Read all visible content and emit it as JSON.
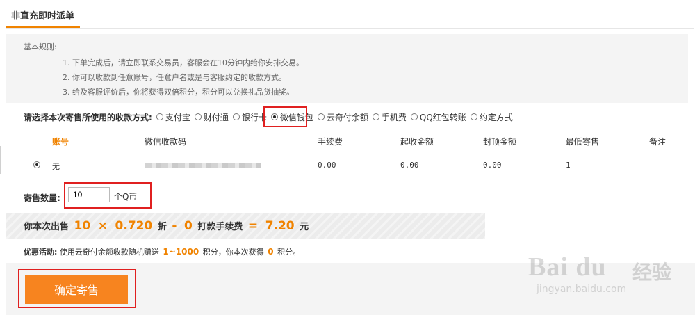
{
  "tab": {
    "label": "非直充即时派单"
  },
  "rules": {
    "title": "基本规则:",
    "items": [
      "1. 下单完成后，请立即联系交易员，客服会在10分钟内给你安排交易。",
      "2. 你可以收款到任意账号，任意户名或是与客服约定的收款方式。",
      "3. 给及客服评价后，你将获得双倍积分，积分可以兑换礼品货抽奖。"
    ]
  },
  "payment": {
    "label": "请选择本次寄售所使用的收款方式:",
    "selected": "微信钱包",
    "options": [
      "支付宝",
      "财付通",
      "银行卡",
      "微信钱包",
      "云奇付余额",
      "手机费",
      "QQ红包转账",
      "约定方式"
    ]
  },
  "account_table": {
    "headers": [
      "账号",
      "微信收款码",
      "手续费",
      "起收金额",
      "封顶金额",
      "最低寄售",
      "备注"
    ],
    "row": {
      "account": "无",
      "fee": "0.00",
      "min_amount": "0.00",
      "max_amount": "0.00",
      "min_sale": "1",
      "note": ""
    }
  },
  "quantity": {
    "label": "寄售数量:",
    "value": "10",
    "unit": "个Q币"
  },
  "calculation": {
    "prefix": "你本次出售",
    "qty": "10",
    "times": "×",
    "rate": "0.720",
    "zhe": "折",
    "minus": "-",
    "fee": "0",
    "fee_label": "打款手续费",
    "equals": "=",
    "total": "7.20",
    "currency": "元"
  },
  "promo": {
    "label": "优惠活动:",
    "text1": "使用云奇付余额收款随机赠送",
    "range": "1~1000",
    "text2": "积分，你本次获得",
    "points": "0",
    "text3": "积分。"
  },
  "confirm_button": {
    "label": "确定寄售"
  },
  "watermark": {
    "brand": "Bai du",
    "cn": "经验",
    "url": "jingyan.baidu.com"
  },
  "colors": {
    "accent": "#f08300",
    "button": "#f7841f",
    "highlight": "#e02020"
  }
}
